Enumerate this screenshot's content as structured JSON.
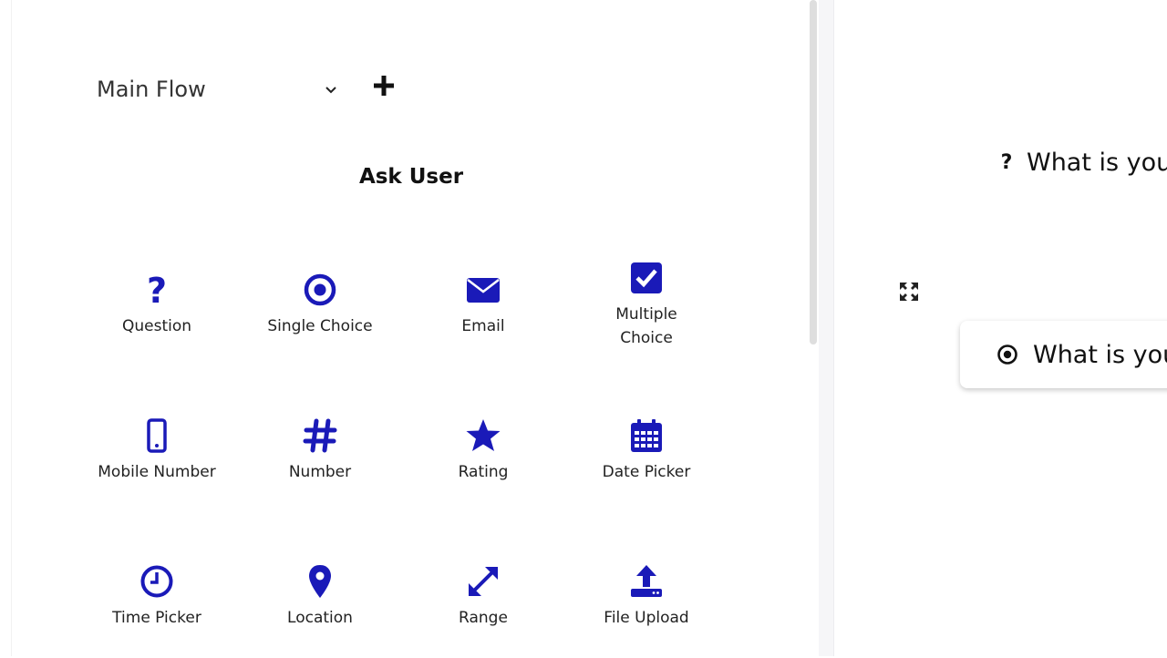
{
  "flow_selector": {
    "label": "Main Flow",
    "icon": "chevron-down-icon"
  },
  "add_flow": {
    "icon": "plus-icon"
  },
  "section_title": "Ask User",
  "accent_color": "#1a1ab8",
  "tiles": [
    {
      "label": "Question",
      "icon": "question-icon"
    },
    {
      "label": "Single Choice",
      "icon": "radio-target-icon"
    },
    {
      "label": "Email",
      "icon": "envelope-icon"
    },
    {
      "label": "Multiple Choice",
      "icon": "checkbox-icon"
    },
    {
      "label": "Mobile Number",
      "icon": "mobile-phone-icon"
    },
    {
      "label": "Number",
      "icon": "hash-icon"
    },
    {
      "label": "Rating",
      "icon": "star-icon"
    },
    {
      "label": "Date Picker",
      "icon": "calendar-icon"
    },
    {
      "label": "Time Picker",
      "icon": "clock-icon"
    },
    {
      "label": "Location",
      "icon": "map-pin-icon"
    },
    {
      "label": "Range",
      "icon": "expand-arrows-icon"
    },
    {
      "label": "File Upload",
      "icon": "upload-icon"
    }
  ],
  "canvas": {
    "node_1": {
      "icon": "question-icon",
      "text": "What is you"
    },
    "expand_icon": "fullscreen-icon",
    "node_2": {
      "icon": "radio-target-icon",
      "text": "What is you"
    }
  }
}
